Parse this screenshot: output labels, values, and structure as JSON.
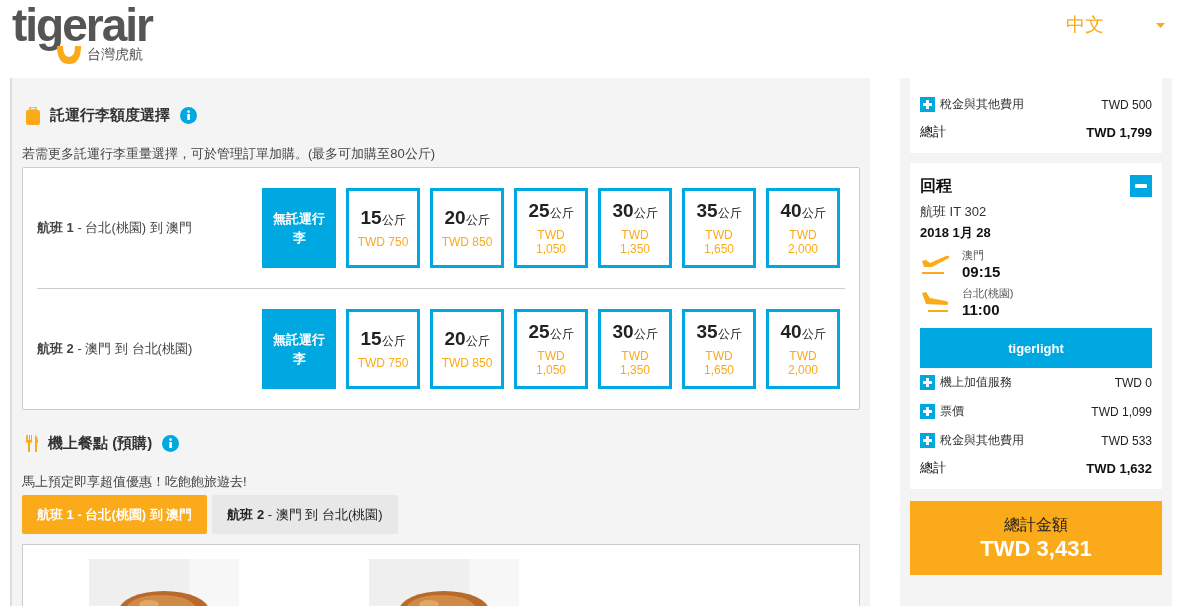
{
  "header": {
    "logo_text": "tigerair",
    "logo_subtitle": "台灣虎航",
    "language": {
      "value": "中文"
    }
  },
  "baggage": {
    "title": "託運行李額度選擇",
    "note": "若需更多託運行李重量選擇，可於管理訂單加購。(最多可加購至80公斤)",
    "flights": [
      {
        "label": "**航班 1** - 台北(桃園) 到 澳門",
        "options": [
          {
            "kind": "none",
            "label": "無託運行李",
            "selected": true
          },
          {
            "kind": "weight",
            "weight": "15",
            "unit": "公斤",
            "price": "TWD 750",
            "selected": false
          },
          {
            "kind": "weight",
            "weight": "20",
            "unit": "公斤",
            "price": "TWD 850",
            "selected": false
          },
          {
            "kind": "weight",
            "weight": "25",
            "unit": "公斤",
            "price": "TWD 1,050",
            "selected": false
          },
          {
            "kind": "weight",
            "weight": "30",
            "unit": "公斤",
            "price": "TWD 1,350",
            "selected": false
          },
          {
            "kind": "weight",
            "weight": "35",
            "unit": "公斤",
            "price": "TWD 1,650",
            "selected": false
          },
          {
            "kind": "weight",
            "weight": "40",
            "unit": "公斤",
            "price": "TWD 2,000",
            "selected": false
          }
        ]
      },
      {
        "label": "**航班 2** - 澳門 到 台北(桃園)",
        "options": [
          {
            "kind": "none",
            "label": "無託運行李",
            "selected": true
          },
          {
            "kind": "weight",
            "weight": "15",
            "unit": "公斤",
            "price": "TWD 750",
            "selected": false
          },
          {
            "kind": "weight",
            "weight": "20",
            "unit": "公斤",
            "price": "TWD 850",
            "selected": false
          },
          {
            "kind": "weight",
            "weight": "25",
            "unit": "公斤",
            "price": "TWD 1,050",
            "selected": false
          },
          {
            "kind": "weight",
            "weight": "30",
            "unit": "公斤",
            "price": "TWD 1,350",
            "selected": false
          },
          {
            "kind": "weight",
            "weight": "35",
            "unit": "公斤",
            "price": "TWD 1,650",
            "selected": false
          },
          {
            "kind": "weight",
            "weight": "40",
            "unit": "公斤",
            "price": "TWD 2,000",
            "selected": false
          }
        ]
      }
    ]
  },
  "meals": {
    "title": "機上餐點 (預購)",
    "note": "馬上預定即享超值優惠！吃飽飽旅遊去!",
    "tabs": [
      {
        "label": "**航班 1** - 台北(桃園) 到 澳門",
        "selected": true
      },
      {
        "label": "**航班 2** - 澳門 到 台北(桃園)",
        "selected": false
      }
    ]
  },
  "summary": {
    "outbound": {
      "rows": [
        {
          "label": "稅金與其他費用",
          "amount": "TWD 500"
        }
      ],
      "total_label": "總計",
      "total": "TWD 1,799"
    },
    "return": {
      "title": "回程",
      "expanded": true,
      "flight": "航班 IT 302",
      "date": "2018 1月 28",
      "segments": [
        {
          "kind": "departure",
          "city": "澳門",
          "time": "09:15"
        },
        {
          "kind": "arrival",
          "city": "台北(桃園)",
          "time": "11:00"
        }
      ],
      "fare": "tigerlight",
      "rows": [
        {
          "label": "機上加值服務",
          "amount": "TWD 0"
        },
        {
          "label": "票價",
          "amount": "TWD 1,099"
        },
        {
          "label": "稅金與其他費用",
          "amount": "TWD 533"
        }
      ],
      "total_label": "總計",
      "total": "TWD 1,632"
    },
    "grand_total": {
      "label": "總計金額",
      "amount": "TWD 3,431"
    }
  }
}
